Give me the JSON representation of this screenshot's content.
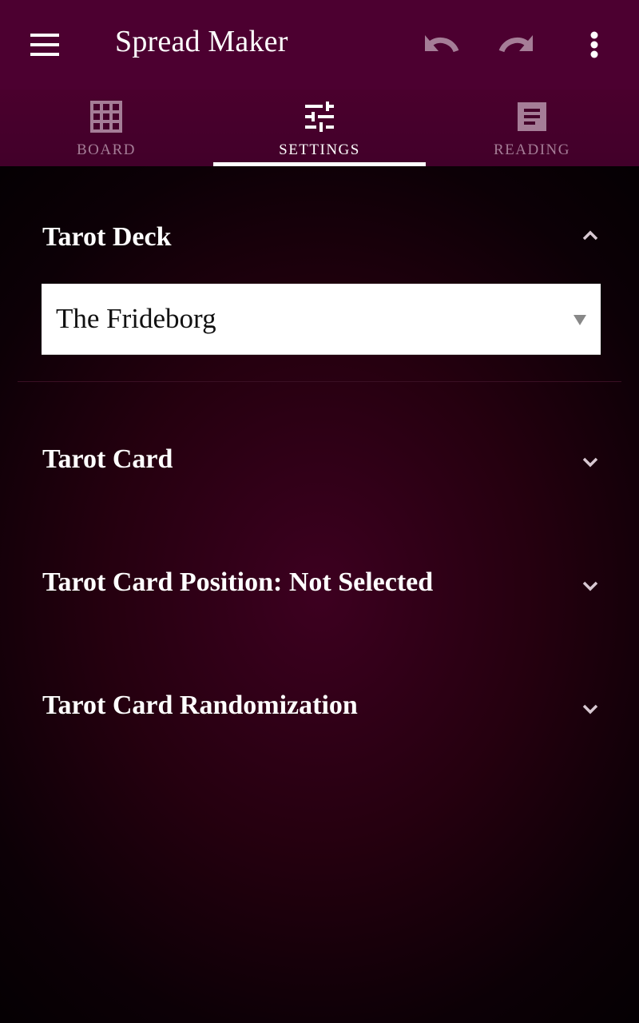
{
  "app": {
    "title": "Spread Maker",
    "menu_icon": "hamburger-menu-icon",
    "actions": [
      {
        "name": "undo",
        "icon": "undo-icon"
      },
      {
        "name": "redo",
        "icon": "redo-icon"
      },
      {
        "name": "more",
        "icon": "more-vert-icon"
      }
    ]
  },
  "tabs": [
    {
      "label": "BOARD",
      "icon": "grid-icon",
      "active": false
    },
    {
      "label": "SETTINGS",
      "icon": "tune-sliders-icon",
      "active": true
    },
    {
      "label": "READING",
      "icon": "document-icon",
      "active": false
    }
  ],
  "sections": [
    {
      "title": "Tarot Deck",
      "expanded": true,
      "select": {
        "value": "The Frideborg"
      }
    },
    {
      "title": "Tarot Card",
      "expanded": false
    },
    {
      "title": "Tarot Card Position: Not Selected",
      "expanded": false
    },
    {
      "title": "Tarot Card Randomization",
      "expanded": false
    }
  ],
  "colors": {
    "appbar": "#4c0030",
    "tab_inactive": "#a57d97",
    "accent": "#ffffff"
  }
}
